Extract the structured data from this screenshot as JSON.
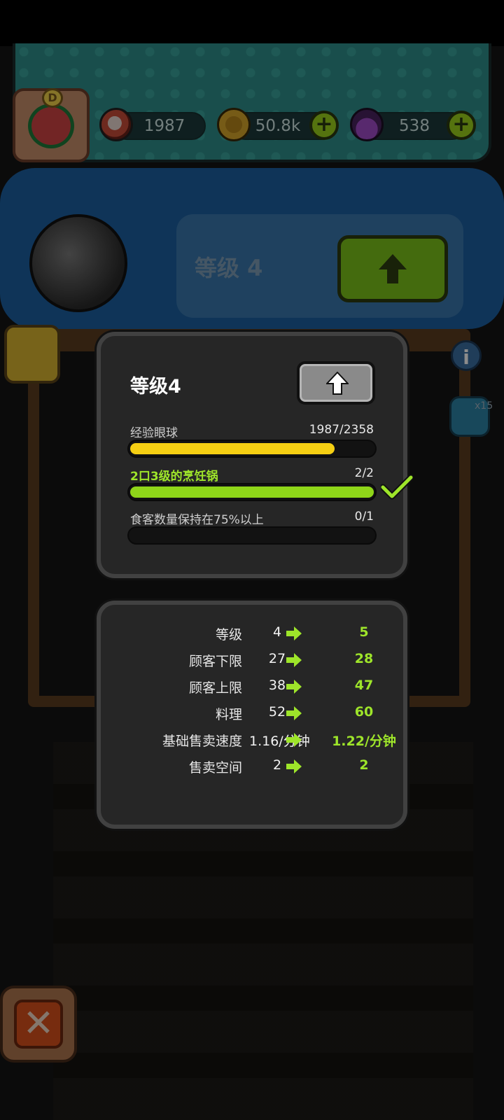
{
  "header": {
    "resources": [
      {
        "name": "eyeball",
        "value": "1987",
        "icon": "eyeball-icon"
      },
      {
        "name": "coin",
        "value": "50.8k",
        "icon": "coin-icon"
      },
      {
        "name": "potion",
        "value": "538",
        "icon": "potion-icon"
      }
    ],
    "plus_label": "+"
  },
  "background": {
    "level_label": "等级 4",
    "side_count": "x15"
  },
  "requirements": {
    "title": "等级4",
    "items": [
      {
        "label": "经验眼球",
        "value": "1987/2358",
        "progress": 0.84,
        "color": "#f5cf13",
        "done": false
      },
      {
        "label": "2口3级的烹饪锅",
        "value": "2/2",
        "progress": 1.0,
        "color": "#8fd619",
        "done": true
      },
      {
        "label": "食客数量保持在75%以上",
        "value": "0/1",
        "progress": 0.0,
        "color": "#8fd619",
        "done": false
      }
    ]
  },
  "stats": [
    {
      "label": "等级",
      "current": "4",
      "next": "5"
    },
    {
      "label": "顾客下限",
      "current": "27",
      "next": "28"
    },
    {
      "label": "顾客上限",
      "current": "38",
      "next": "47"
    },
    {
      "label": "料理",
      "current": "52",
      "next": "60"
    },
    {
      "label": "基础售卖速度",
      "current": "1.16/分钟",
      "next": "1.22/分钟"
    },
    {
      "label": "售卖空间",
      "current": "2",
      "next": "2"
    }
  ],
  "close_label": "✕",
  "colors": {
    "accent_green": "#9ee52a",
    "bar_yellow": "#f5cf13",
    "card_bg": "#262626"
  }
}
